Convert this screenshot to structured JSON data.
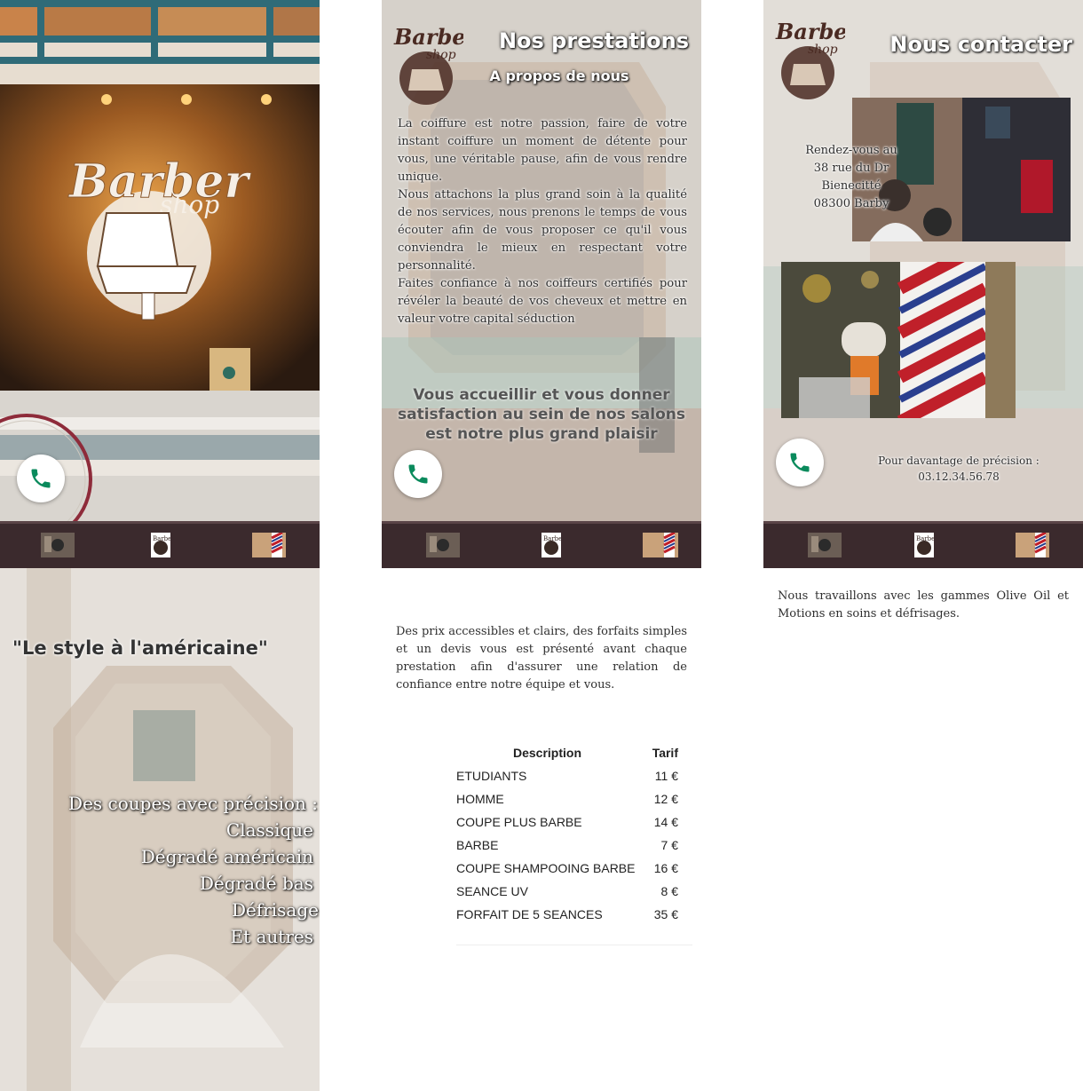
{
  "panel_home": {
    "nav": [
      "barber-photo-thumb",
      "barber-logo-thumb",
      "barber-pole-thumb"
    ]
  },
  "panel_services": {
    "title": "Nos prestations",
    "subtitle": "A propos de nous",
    "about_text": "La coiffure est notre passion, faire de votre instant coiffure un moment de détente pour vous, une véritable pause, afin de vous rendre unique.\nNous attachons la plus grand soin à la qualité de nos services, nous prenons le temps de vous écouter afin de vous proposer ce qu'il vous conviendra le mieux en respectant votre personnalité.\nFaites confiance à nos coiffeurs certifiés pour révéler la beauté de vos cheveux et mettre en valeur votre capital séduction",
    "tagline": "Vous accueillir et vous donner satisfaction au sein de nos salons est notre plus grand plaisir"
  },
  "panel_contact": {
    "title": "Nous contacter",
    "address": "Rendez-vous au\n38 rue du Dr\nBienecitté\n08300 Barby",
    "phone_text": "Pour davantage de précision :\n03.12.34.56.78"
  },
  "panel_style": {
    "title": "\"Le style à l'américaine\"",
    "cuts_heading": "Des coupes avec précision :",
    "cuts": [
      "Classique",
      "Dégradé américain",
      "Dégradé bas",
      "Défrisage",
      "Et autres"
    ]
  },
  "prices": {
    "intro": "Des prix accessibles et clairs, des forfaits simples et un devis vous est présenté avant chaque prestation afin d'assurer une relation de confiance entre notre équipe et vous.",
    "header_desc": "Description",
    "header_price": "Tarif",
    "rows": [
      {
        "desc": "ETUDIANTS",
        "price": "11 €"
      },
      {
        "desc": "HOMME",
        "price": "12 €"
      },
      {
        "desc": "COUPE PLUS BARBE",
        "price": "14 €"
      },
      {
        "desc": "BARBE",
        "price": "7 €"
      },
      {
        "desc": "COUPE SHAMPOOING BARBE",
        "price": "16 €"
      },
      {
        "desc": "SEANCE UV",
        "price": "8 €"
      },
      {
        "desc": "FORFAIT DE 5 SEANCES",
        "price": "35 €"
      }
    ]
  },
  "products": {
    "text": "Nous travaillons avec les gammes Olive Oil et Motions en soins et défrisages."
  },
  "logo": {
    "line1": "Barber",
    "line2": "shop"
  },
  "colors": {
    "navbar": "#3b2a2d",
    "phone_green": "#0a8a5c"
  }
}
